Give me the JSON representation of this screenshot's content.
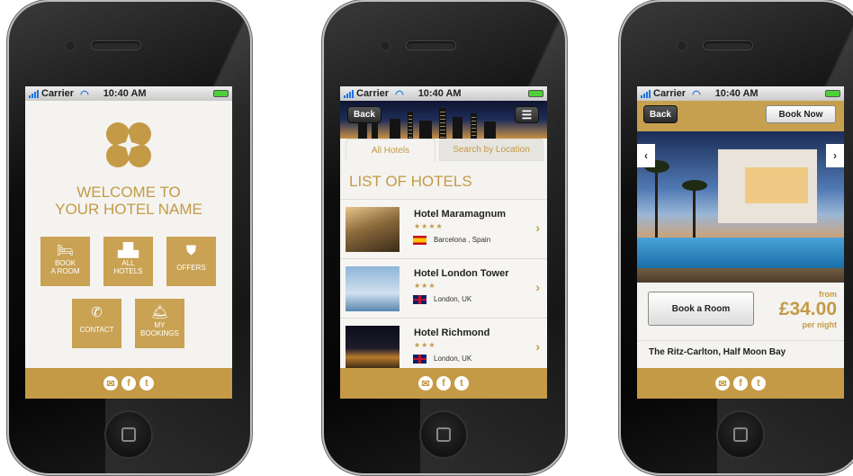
{
  "status": {
    "carrier": "Carrier",
    "time": "10:40 AM"
  },
  "home": {
    "welcome_line1": "WELCOME TO",
    "welcome_line2": "YOUR HOTEL NAME",
    "tiles": [
      {
        "line1": "BOOK",
        "line2": "A ROOM",
        "icon": "bed-icon"
      },
      {
        "line1": "ALL",
        "line2": "HOTELS",
        "icon": "buildings-icon"
      },
      {
        "line1": "OFFERS",
        "line2": "",
        "icon": "bookmark-star-icon"
      },
      {
        "line1": "CONTACT",
        "line2": "",
        "icon": "phone-icon"
      },
      {
        "line1": "MY",
        "line2": "BOOKINGS",
        "icon": "service-bell-icon"
      }
    ]
  },
  "list": {
    "back_label": "Back",
    "tab_all": "All Hotels",
    "tab_location": "Search by Location",
    "title": "LIST OF HOTELS",
    "hotels": [
      {
        "name": "Hotel Maramagnum",
        "stars": "★★★★",
        "location": "Barcelona , Spain"
      },
      {
        "name": "Hotel London Tower",
        "stars": "★★★",
        "location": "London, UK"
      },
      {
        "name": "Hotel Richmond",
        "stars": "★★★",
        "location": "London, UK"
      }
    ]
  },
  "detail": {
    "back_label": "Back",
    "book_now_label": "Book Now",
    "book_room_label": "Book a Room",
    "from_label": "from",
    "price": "£34.00",
    "per_night": "per night",
    "hotel_name": "The Ritz-Carlton, Half Moon Bay",
    "prev_arrow": "‹",
    "next_arrow": "›"
  },
  "social": {
    "email": "✉",
    "facebook": "f",
    "twitter": "t"
  },
  "colors": {
    "gold": "#c49a46",
    "tile": "#c9a254"
  }
}
